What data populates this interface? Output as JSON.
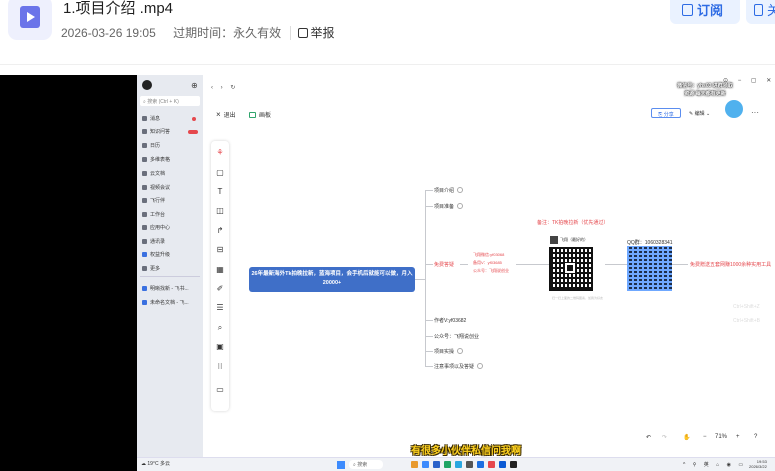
{
  "header": {
    "file_title": "1.项目介绍 .mp4",
    "date": "2026-03-26 19:05",
    "expire_text": "过期时间：永久有效",
    "report_label": "举报",
    "subscribe_label": "订阅",
    "second_button_label": "关"
  },
  "video": {
    "subtitle": "有很多小伙伴私信问我啊",
    "watermark": "微信号：yhs03 进群领取资源 每天都有更新",
    "app": {
      "sidebar": {
        "search_placeholder": "搜索 (Ctrl + K)",
        "items": [
          {
            "label": "消息"
          },
          {
            "label": "知识问答"
          },
          {
            "label": "日历"
          },
          {
            "label": "多维表格"
          },
          {
            "label": "云文档"
          },
          {
            "label": "视频会议"
          },
          {
            "label": "飞行伴"
          },
          {
            "label": "工作台"
          },
          {
            "label": "应用中心"
          },
          {
            "label": "通讯录"
          },
          {
            "label": "权益升级"
          },
          {
            "label": "更多"
          }
        ],
        "recent": [
          {
            "label": "明晰找新 - 飞书..."
          },
          {
            "label": "未命名文档 - 飞..."
          }
        ]
      },
      "canvas_header": {
        "exit_label": "退出",
        "flag_label": "画板",
        "share_label": "分享",
        "edit_label": "编辑"
      },
      "mindmap": {
        "central": "26年最新海外Tk拍晚拉新，蓝海项目，会手机后就能可以做，月入20000+",
        "nodes": [
          {
            "label": "项目介绍"
          },
          {
            "label": "项目准备"
          },
          {
            "label": "免费答疑"
          },
          {
            "label": "作者V:yf03682"
          },
          {
            "label": "公众号：飞翔说创业"
          },
          {
            "label": "项目实操"
          },
          {
            "label": "注意事项以及答疑"
          }
        ],
        "detail_lines": [
          "飞翔微信:yf03068",
          "备用V：yf03685",
          "公众号：飞翔说创业"
        ],
        "note_label": "备注：TK拍晚拉新（优先通过）",
        "wechat_label": "飞翔（最好的）",
        "qq_label": "QQ群：1060328341",
        "scan_caption": "扫一扫上面的二维码图案，加我为好友",
        "right_node": "免费赠送五套网赚1000余种实用工具",
        "ghost_texts": [
          "Ctrl+Shift+Z",
          "Ctrl+Shift+B"
        ]
      },
      "zoom": {
        "value": "71%",
        "minus": "−",
        "plus": "+"
      },
      "taskbar": {
        "weather_temp": "19°C",
        "weather_desc": "多云",
        "search_label": "搜索",
        "time": "19:53",
        "date": "2026/3/22"
      }
    }
  },
  "colors": {
    "accent": "#2d6be4",
    "central_node": "#3f6fc8",
    "subtitle": "#ffd21f",
    "red": "#e5484d"
  }
}
